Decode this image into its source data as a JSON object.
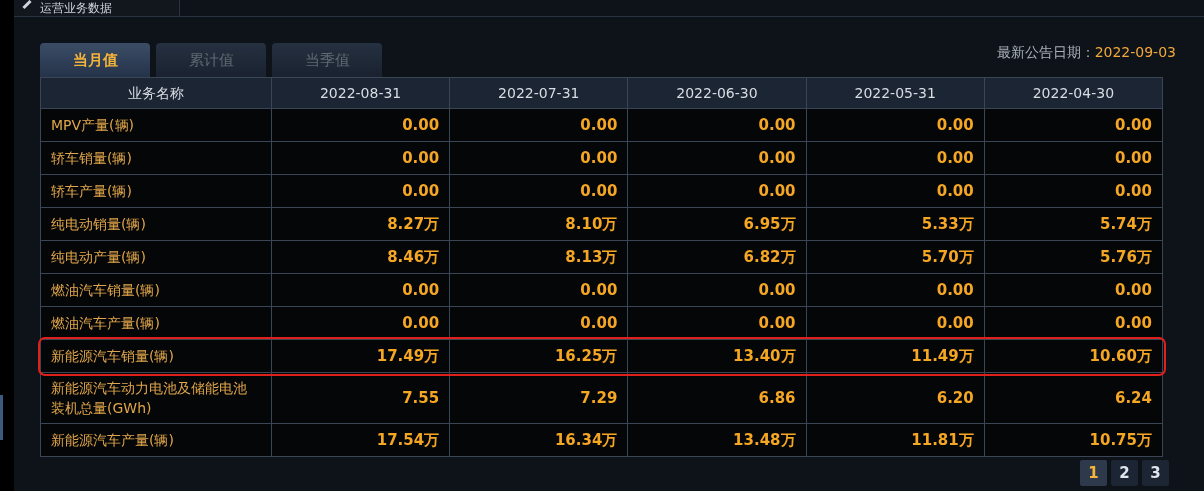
{
  "panel": {
    "title": "运营业务数据"
  },
  "tabs": [
    {
      "label": "当月值",
      "selected": true
    },
    {
      "label": "累计值",
      "selected": false
    },
    {
      "label": "当季值",
      "selected": false
    }
  ],
  "announcement": {
    "label": "最新公告日期：",
    "date": "2022-09-03"
  },
  "table": {
    "columns": [
      "业务名称",
      "2022-08-31",
      "2022-07-31",
      "2022-06-30",
      "2022-05-31",
      "2022-04-30"
    ],
    "rows": [
      {
        "name": "MPV产量(辆)",
        "values": [
          "0.00",
          "0.00",
          "0.00",
          "0.00",
          "0.00"
        ],
        "highlighted": false
      },
      {
        "name": "轿车销量(辆)",
        "values": [
          "0.00",
          "0.00",
          "0.00",
          "0.00",
          "0.00"
        ],
        "highlighted": false
      },
      {
        "name": "轿车产量(辆)",
        "values": [
          "0.00",
          "0.00",
          "0.00",
          "0.00",
          "0.00"
        ],
        "highlighted": false
      },
      {
        "name": "纯电动销量(辆)",
        "values": [
          "8.27万",
          "8.10万",
          "6.95万",
          "5.33万",
          "5.74万"
        ],
        "highlighted": false
      },
      {
        "name": "纯电动产量(辆)",
        "values": [
          "8.46万",
          "8.13万",
          "6.82万",
          "5.70万",
          "5.76万"
        ],
        "highlighted": false
      },
      {
        "name": "燃油汽车销量(辆)",
        "values": [
          "0.00",
          "0.00",
          "0.00",
          "0.00",
          "0.00"
        ],
        "highlighted": false
      },
      {
        "name": "燃油汽车产量(辆)",
        "values": [
          "0.00",
          "0.00",
          "0.00",
          "0.00",
          "0.00"
        ],
        "highlighted": false
      },
      {
        "name": "新能源汽车销量(辆)",
        "values": [
          "17.49万",
          "16.25万",
          "13.40万",
          "11.49万",
          "10.60万"
        ],
        "highlighted": true
      },
      {
        "name": "新能源汽车动力电池及储能电池装机总量(GWh)",
        "values": [
          "7.55",
          "7.29",
          "6.86",
          "6.20",
          "6.24"
        ],
        "highlighted": false
      },
      {
        "name": "新能源汽车产量(辆)",
        "values": [
          "17.54万",
          "16.34万",
          "13.48万",
          "11.81万",
          "10.75万"
        ],
        "highlighted": false
      }
    ]
  },
  "pagination": [
    {
      "label": "1",
      "selected": true
    },
    {
      "label": "2",
      "selected": false
    },
    {
      "label": "3",
      "selected": false
    }
  ]
}
